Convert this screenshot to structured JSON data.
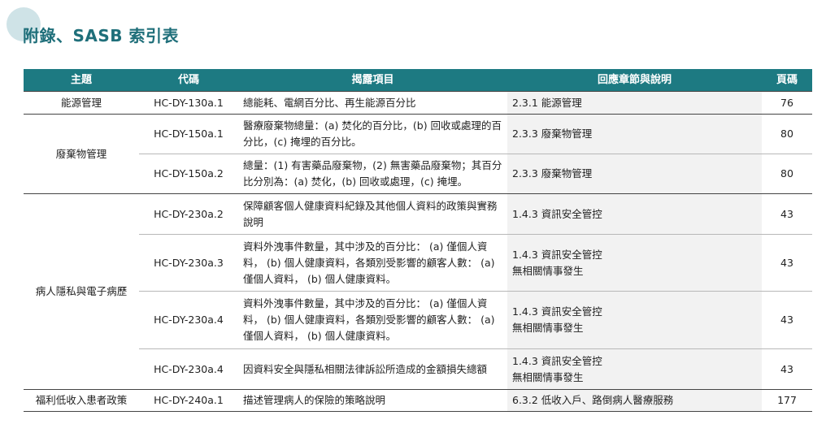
{
  "title": "附錄、SASB 索引表",
  "headers": [
    "主題",
    "代碼",
    "揭露項目",
    "回應章節與說明",
    "頁碼"
  ],
  "rows": [
    {
      "topic": "能源管理",
      "code": "HC-DY-130a.1",
      "disc": "總能耗、電網百分比、再生能源百分比",
      "sect1": "2.3.1 能源管理",
      "sect2": "",
      "page": "76"
    },
    {
      "topic": "廢棄物管理",
      "code": "HC-DY-150a.1",
      "disc": "醫療廢棄物總量：(a) 焚化的百分比，(b) 回收或處理的百分比，(c) 掩埋的百分比。",
      "sect1": "2.3.3 廢棄物管理",
      "sect2": "",
      "page": "80"
    },
    {
      "topic": "",
      "code": "HC-DY-150a.2",
      "disc": "總量：(1) 有害藥品廢棄物，(2) 無害藥品廢棄物；其百分比分別為：(a) 焚化，(b) 回收或處理，(c) 掩埋。",
      "sect1": "2.3.3 廢棄物管理",
      "sect2": "",
      "page": "80"
    },
    {
      "topic": "病人隱私與電子病歷",
      "code": "HC-DY-230a.2",
      "disc": "保障顧客個人健康資料紀錄及其他個人資料的政策與實務說明",
      "sect1": "1.4.3 資訊安全管控",
      "sect2": "",
      "page": "43"
    },
    {
      "topic": "",
      "code": "HC-DY-230a.3",
      "disc": "資料外洩事件數量，其中涉及的百分比： (a) 僅個人資料， (b) 個人健康資料，各類別受影響的顧客人數： (a) 僅個人資料， (b) 個人健康資料。",
      "sect1": "1.4.3 資訊安全管控",
      "sect2": "無相關情事發生",
      "page": "43"
    },
    {
      "topic": "",
      "code": "HC-DY-230a.4",
      "disc": "資料外洩事件數量，其中涉及的百分比： (a) 僅個人資料， (b) 個人健康資料，各類別受影響的顧客人數： (a) 僅個人資料， (b) 個人健康資料。",
      "sect1": "1.4.3 資訊安全管控",
      "sect2": "無相關情事發生",
      "page": "43"
    },
    {
      "topic": "",
      "code": "HC-DY-230a.4",
      "disc": "因資料安全與隱私相關法律訴訟所造成的金額損失總額",
      "sect1": "1.4.3 資訊安全管控",
      "sect2": "無相關情事發生",
      "page": "43"
    },
    {
      "topic": "福利低收入患者政策",
      "code": "HC-DY-240a.1",
      "disc": "描述管理病人的保險的策略說明",
      "sect1": "6.3.2 低收入戶、路倒病人醫療服務",
      "sect2": "",
      "page": "177"
    }
  ]
}
